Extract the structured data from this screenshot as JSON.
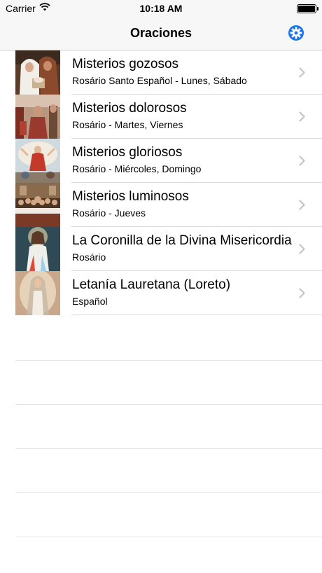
{
  "status_bar": {
    "carrier": "Carrier",
    "time": "10:18 AM"
  },
  "nav": {
    "title": "Oraciones",
    "settings_icon": "gear-icon",
    "accent": "#1a73e8"
  },
  "rows": [
    {
      "title": "Misterios gozosos",
      "subtitle": "Rosário Santo Español - Lunes, Sábado"
    },
    {
      "title": "Misterios dolorosos",
      "subtitle": "Rosário - Martes, Viernes"
    },
    {
      "title": "Misterios gloriosos",
      "subtitle": "Rosário - Miércoles, Domingo"
    },
    {
      "title": "Misterios luminosos",
      "subtitle": "Rosário - Jueves"
    },
    {
      "title": "La Coronilla de la Divina Misericordia",
      "subtitle": "Rosário"
    },
    {
      "title": "Letanía Lauretana (Loreto)",
      "subtitle": "Español"
    }
  ]
}
